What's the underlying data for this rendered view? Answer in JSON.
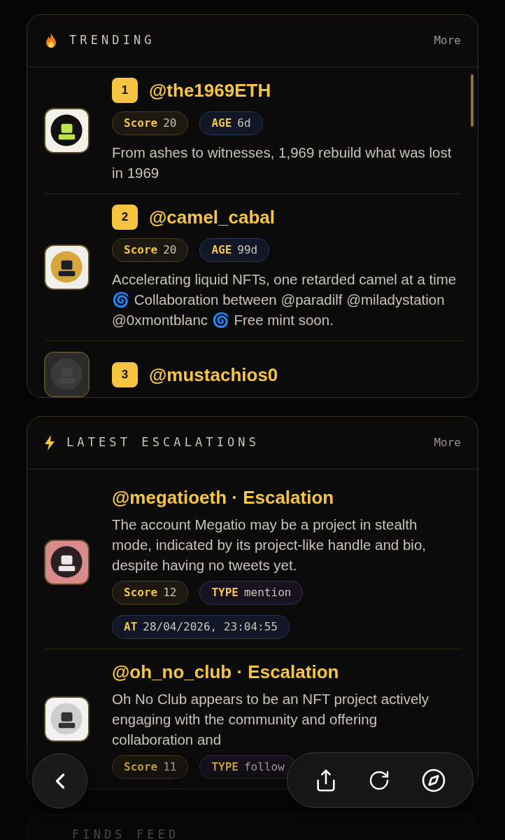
{
  "trending": {
    "title": "TRENDING",
    "more": "More",
    "items": [
      {
        "rank": "1",
        "handle": "@the1969ETH",
        "pills": [
          {
            "kind": "score",
            "label": "Score",
            "value": "20"
          },
          {
            "kind": "age",
            "label": "AGE",
            "value": "6d"
          }
        ],
        "description": "From ashes to witnesses, 1,969 rebuild what was lost in 1969"
      },
      {
        "rank": "2",
        "handle": "@camel_cabal",
        "pills": [
          {
            "kind": "score",
            "label": "Score",
            "value": "20"
          },
          {
            "kind": "age",
            "label": "AGE",
            "value": "99d"
          }
        ],
        "description": "Accelerating liquid NFTs, one retarded camel at a time 🌀 Collaboration between @paradilf @miladystation @0xmontblanc 🌀 Free mint soon."
      },
      {
        "rank": "3",
        "handle": "@mustachios0"
      }
    ]
  },
  "escalations": {
    "title": "LATEST ESCALATIONS",
    "more": "More",
    "items": [
      {
        "title": "@megatioeth · Escalation",
        "description": "The account Megatio may be a project in stealth mode, indicated by its project-like handle and bio, despite having no tweets yet.",
        "pills": [
          {
            "kind": "score",
            "label": "Score",
            "value": "12"
          },
          {
            "kind": "type",
            "label": "TYPE",
            "value": "mention"
          },
          {
            "kind": "at",
            "label": "AT",
            "value": "28/04/2026, 23:04:55"
          }
        ]
      },
      {
        "title": "@oh_no_club · Escalation",
        "description": "Oh No Club appears to be an NFT project actively engaging with the community and offering collaboration and",
        "pills": [
          {
            "kind": "score",
            "label": "Score",
            "value": "11"
          },
          {
            "kind": "type",
            "label": "TYPE",
            "value": "follow"
          }
        ]
      }
    ]
  },
  "finds": {
    "title": "FINDS FEED"
  }
}
